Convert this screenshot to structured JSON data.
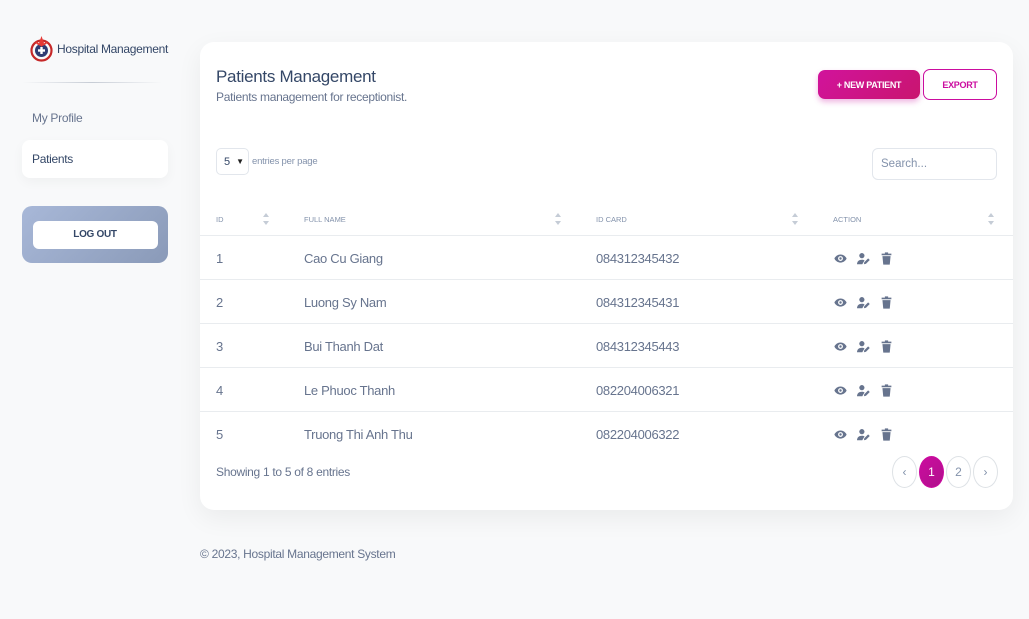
{
  "sidebar": {
    "brand": "Hospital Management",
    "items": [
      {
        "label": "My Profile",
        "active": false
      },
      {
        "label": "Patients",
        "active": true
      }
    ],
    "logout_label": "LOG OUT"
  },
  "header": {
    "title": "Patients Management",
    "subtitle": "Patients management for receptionist.",
    "new_patient_label": "+ NEW PATIENT",
    "export_label": "EXPORT"
  },
  "table_controls": {
    "per_page_value": "5",
    "per_page_label": "entries per page",
    "search_placeholder": "Search..."
  },
  "table": {
    "columns": [
      "ID",
      "FULL NAME",
      "ID CARD",
      "ACTION"
    ],
    "rows": [
      {
        "id": "1",
        "name": "Cao Cu Giang",
        "card": "084312345432"
      },
      {
        "id": "2",
        "name": "Luong Sy Nam",
        "card": "084312345431"
      },
      {
        "id": "3",
        "name": "Bui Thanh Dat",
        "card": "084312345443"
      },
      {
        "id": "4",
        "name": "Le Phuoc Thanh",
        "card": "082204006321"
      },
      {
        "id": "5",
        "name": "Truong Thi Anh Thu",
        "card": "082204006322"
      }
    ],
    "action_icons": [
      "eye-icon",
      "user-edit-icon",
      "trash-icon"
    ]
  },
  "pagination": {
    "showing": "Showing 1 to 5 of 8 entries",
    "prev": "‹",
    "pages": [
      "1",
      "2"
    ],
    "next": "›",
    "current": "1"
  },
  "footer": "© 2023, Hospital Management System",
  "colors": {
    "accent": "#cb0c9f",
    "text_dark": "#344767",
    "text_muted": "#67748e"
  }
}
